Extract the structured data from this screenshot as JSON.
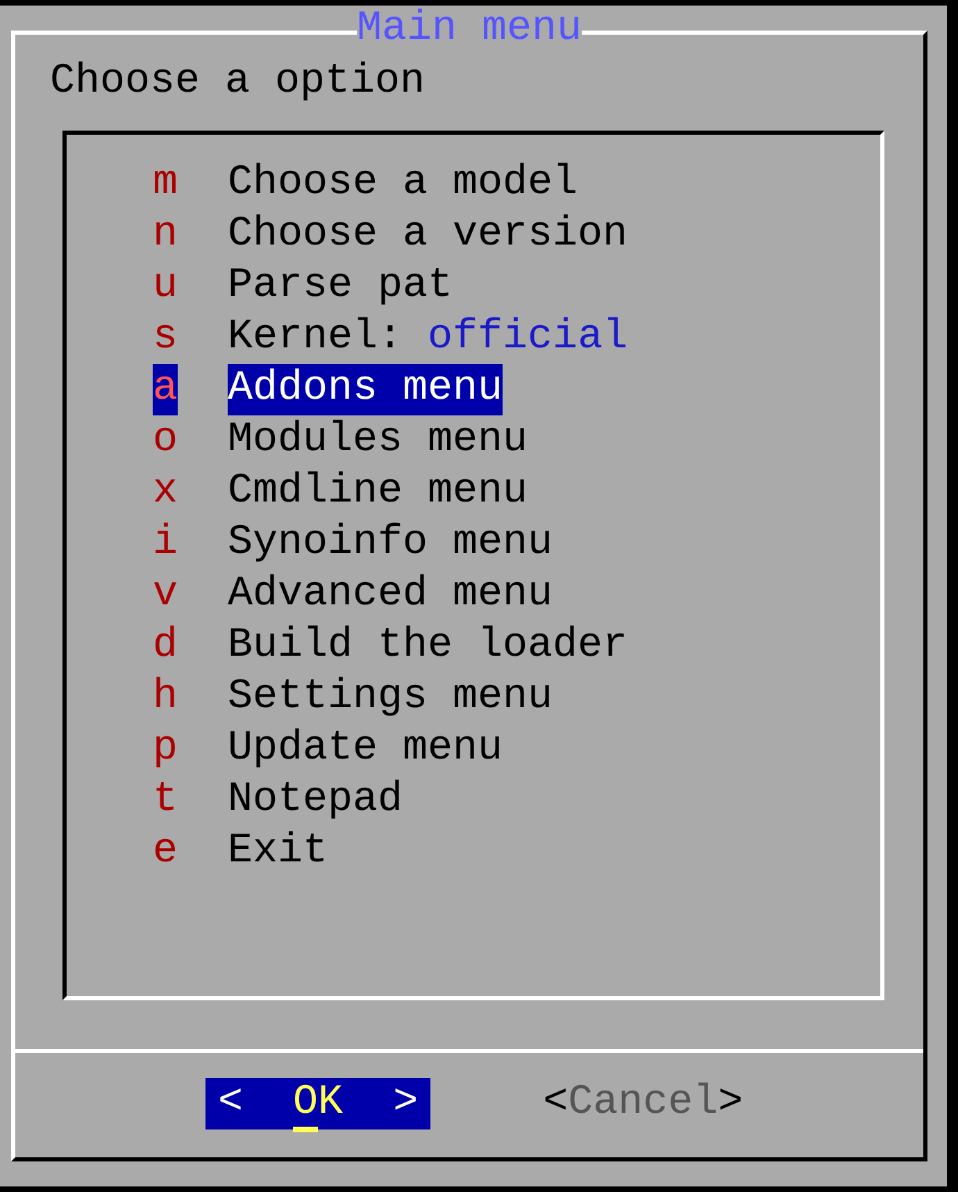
{
  "dialog": {
    "title": "Main menu",
    "prompt": "Choose a option"
  },
  "items": [
    {
      "hotkey": "m",
      "label": "Choose a model",
      "selected": false
    },
    {
      "hotkey": "n",
      "label": "Choose a version",
      "selected": false
    },
    {
      "hotkey": "u",
      "label": "Parse pat",
      "selected": false
    },
    {
      "hotkey": "s",
      "label": "Kernel:",
      "value": "official",
      "selected": false
    },
    {
      "hotkey": "a",
      "label": "Addons menu",
      "selected": true
    },
    {
      "hotkey": "o",
      "label": "Modules menu",
      "selected": false
    },
    {
      "hotkey": "x",
      "label": "Cmdline menu",
      "selected": false
    },
    {
      "hotkey": "i",
      "label": "Synoinfo menu",
      "selected": false
    },
    {
      "hotkey": "v",
      "label": "Advanced menu",
      "selected": false
    },
    {
      "hotkey": "d",
      "label": "Build the loader",
      "selected": false
    },
    {
      "hotkey": "h",
      "label": "Settings menu",
      "selected": false
    },
    {
      "hotkey": "p",
      "label": "Update menu",
      "selected": false
    },
    {
      "hotkey": "t",
      "label": "Notepad",
      "selected": false
    },
    {
      "hotkey": "e",
      "label": "Exit",
      "selected": false
    }
  ],
  "buttons": [
    {
      "open": "<",
      "label": "OK",
      "close": ">",
      "selected": true
    },
    {
      "open": "<",
      "label": "Cancel",
      "close": ">",
      "selected": false
    }
  ]
}
